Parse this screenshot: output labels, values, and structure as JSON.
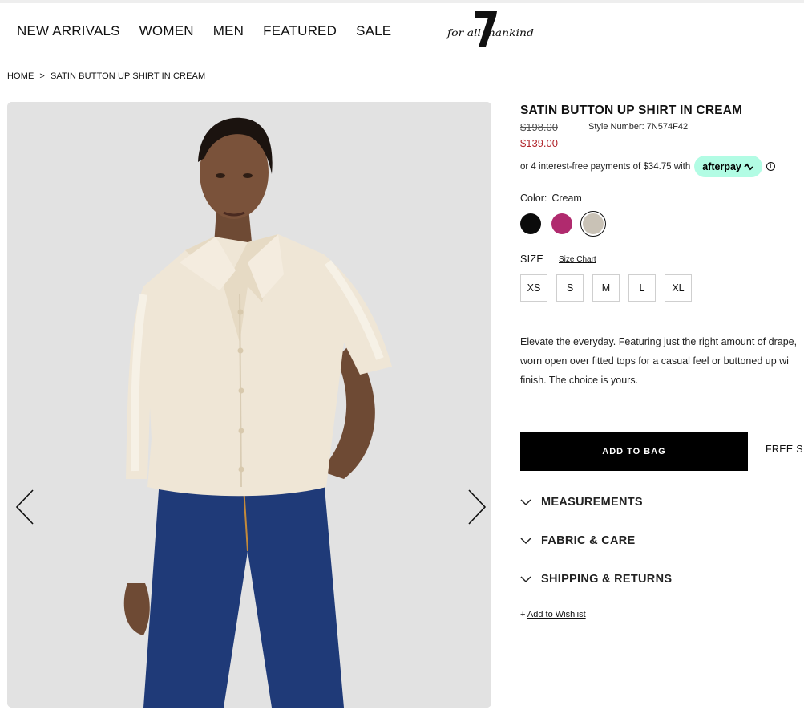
{
  "nav": {
    "items": [
      "NEW ARRIVALS",
      "WOMEN",
      "MEN",
      "FEATURED",
      "SALE"
    ],
    "logo_text": "for all mankind",
    "logo_numeral": "7"
  },
  "breadcrumb": {
    "home": "HOME",
    "separator": ">",
    "current": "SATIN BUTTON UP SHIRT IN CREAM"
  },
  "product": {
    "title": "SATIN BUTTON UP SHIRT IN CREAM",
    "original_price": "$198.00",
    "style_number": "Style Number: 7N574F42",
    "sale_price": "$139.00",
    "afterpay_text": "or 4 interest-free payments of $34.75 with",
    "afterpay_brand": "afterpay",
    "info_icon": "i",
    "color_label": "Color:",
    "color_value": "Cream",
    "swatches": [
      {
        "name": "Black",
        "color": "#0b0b0b"
      },
      {
        "name": "Magenta",
        "color": "#b02a6e"
      },
      {
        "name": "Cream",
        "color": "#c9c2b6"
      }
    ],
    "selected_swatch": 2,
    "size_label": "SIZE",
    "size_chart_label": "Size Chart",
    "sizes": [
      "XS",
      "S",
      "M",
      "L",
      "XL"
    ],
    "description_lines": [
      "Elevate the everyday. Featuring just the right amount of drape,",
      "worn open over fitted tops for a casual feel or buttoned up wi",
      "finish. The choice is yours."
    ],
    "add_to_bag": "ADD TO BAG",
    "free_shipping": "FREE SH",
    "accordions": [
      "MEASUREMENTS",
      "FABRIC & CARE",
      "SHIPPING & RETURNS"
    ],
    "wishlist_prefix": "+",
    "wishlist_label": "Add to Wishlist"
  },
  "colors": {
    "sale_red": "#b0232a",
    "afterpay_mint": "#b2fce4",
    "gallery_bg": "#e2e2e2"
  },
  "icons": {
    "gallery_prev": "chevron-left-icon",
    "gallery_next": "chevron-right-icon",
    "accordion": "chevron-down-icon",
    "afterpay_loop": "afterpay-loop-icon"
  }
}
